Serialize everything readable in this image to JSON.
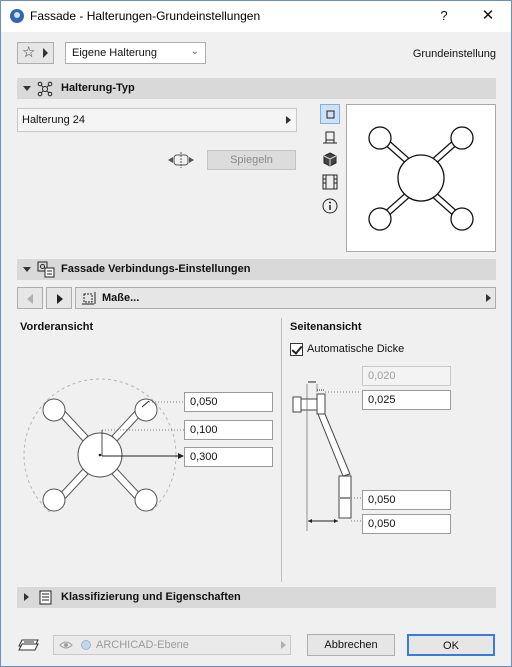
{
  "window": {
    "title": "Fassade - Halterungen-Grundeinstellungen",
    "help": "?",
    "close": "✕"
  },
  "toolbar": {
    "favorites_icon": "star-icon",
    "preset_value": "Eigene Halterung",
    "preset_label": "Grundeinstellung"
  },
  "section_type": {
    "title": "Halterung-Typ",
    "type_value": "Halterung 24",
    "mirror_label": "Spiegeln"
  },
  "section_connection": {
    "title": "Fassade Verbindungs-Einstellungen",
    "page_label": "Maße..."
  },
  "front_view": {
    "title": "Vorderansicht",
    "fields": [
      "0,050",
      "0,100",
      "0,300"
    ]
  },
  "side_view": {
    "title": "Seitenansicht",
    "auto_thickness_label": "Automatische Dicke",
    "auto_thickness_checked": true,
    "fields": [
      "0,020",
      "0,025",
      "0,050",
      "0,050"
    ]
  },
  "section_class": {
    "title": "Klassifizierung und Eigenschaften"
  },
  "footer": {
    "layer_value": "ARCHICAD-Ebene",
    "cancel_label": "Abbrechen",
    "ok_label": "OK"
  }
}
